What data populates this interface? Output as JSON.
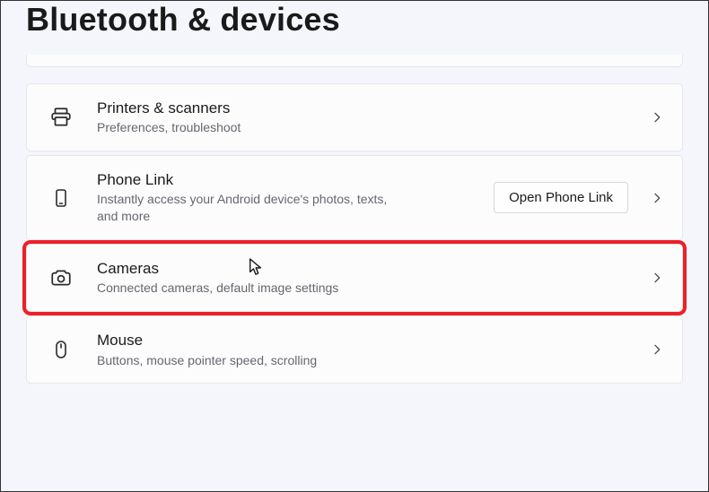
{
  "page_title": "Bluetooth & devices",
  "rows": {
    "printers": {
      "title": "Printers & scanners",
      "desc": "Preferences, troubleshoot"
    },
    "phone_link": {
      "title": "Phone Link",
      "desc": "Instantly access your Android device's photos, texts, and more",
      "button_label": "Open Phone Link"
    },
    "cameras": {
      "title": "Cameras",
      "desc": "Connected cameras, default image settings"
    },
    "mouse": {
      "title": "Mouse",
      "desc": "Buttons, mouse pointer speed, scrolling"
    }
  },
  "highlight_color": "#ed2027"
}
